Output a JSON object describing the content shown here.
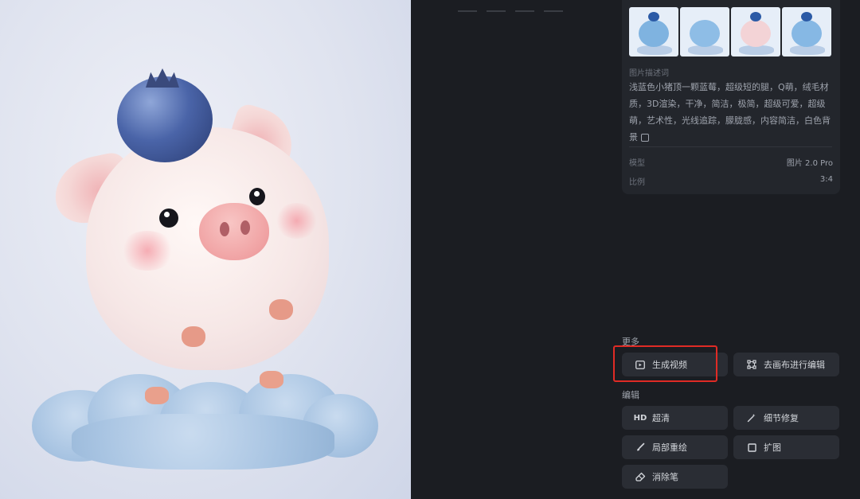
{
  "app": {
    "title": ""
  },
  "preview": {
    "alt": ""
  },
  "details": {
    "thumbnails": [
      "thumb-1",
      "thumb-2",
      "thumb-3",
      "thumb-4"
    ],
    "prompt_label": "图片描述词",
    "prompt_text": "浅蓝色小猪顶一颗蓝莓，超级短的腿，Q萌，绒毛材质，3D渲染，干净，简洁，极简，超级可爱，超级萌，艺术性，光线追踪，朦胧感，内容简洁，白色背景",
    "model_label": "模型",
    "model_value": "图片 2.0 Pro",
    "ratio_label": "比例",
    "ratio_value": "3:4"
  },
  "more": {
    "label": "更多",
    "generate_video": "生成视频",
    "canvas_edit": "去画布进行编辑"
  },
  "edit": {
    "label": "编辑",
    "hd": "超清",
    "hd_icon_text": "HD",
    "detail_fix": "细节修复",
    "inpaint": "局部重绘",
    "expand": "扩图",
    "eraser": "消除笔"
  },
  "colors": {
    "background": "#1b1d22",
    "button": "#2a2d34",
    "highlight": "#e02b25"
  }
}
